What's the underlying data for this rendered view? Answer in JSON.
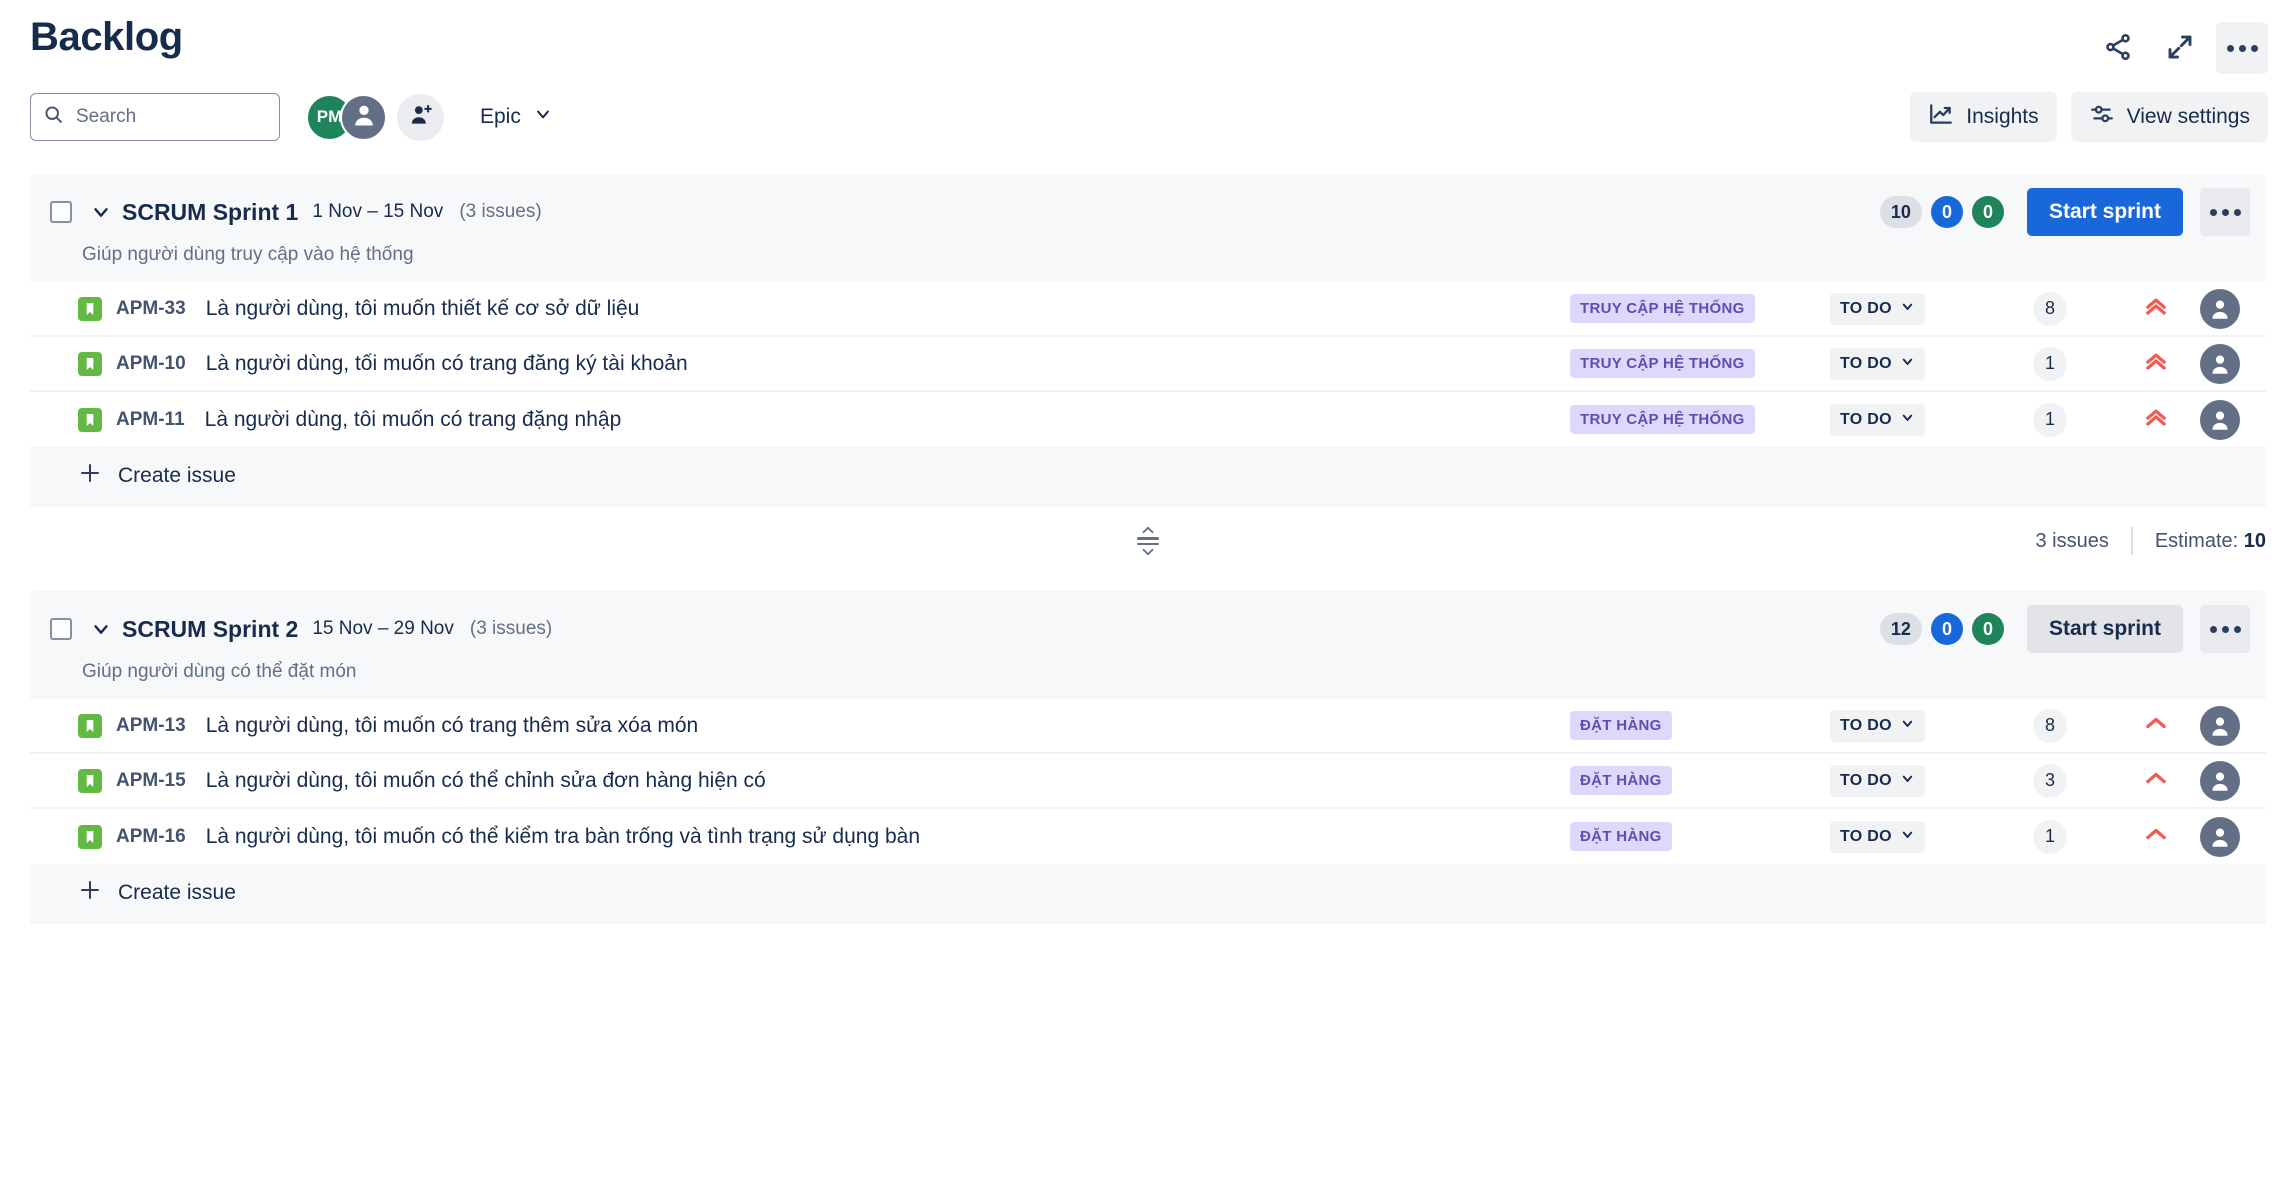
{
  "header": {
    "title": "Backlog",
    "actions": [
      {
        "name": "share-icon",
        "label": "Share"
      },
      {
        "name": "expand-icon",
        "label": "Expand"
      },
      {
        "name": "more-actions-icon",
        "label": "More actions"
      }
    ]
  },
  "toolbar": {
    "search": {
      "placeholder": "Search",
      "value": ""
    },
    "avatars": [
      {
        "initials": "PM",
        "color": "#1F845A"
      },
      {
        "initials": "",
        "color": "#626F86"
      }
    ],
    "add_people_label": "Add people",
    "epic_filter": {
      "label": "Epic"
    },
    "insights_label": "Insights",
    "view_settings_label": "View settings"
  },
  "sprints": [
    {
      "name": "SCRUM Sprint 1",
      "dates": "1 Nov – 15 Nov",
      "issue_count": "(3 issues)",
      "goal": "Giúp người dùng truy cập vào hệ thống",
      "badges": {
        "todo": "10",
        "inprogress": "0",
        "done": "0"
      },
      "start_button": "Start sprint",
      "start_button_style": "primary",
      "create_issue_label": "Create issue",
      "issues": [
        {
          "type": "story",
          "key": "APM-33",
          "summary": "Là người dùng, tôi muốn thiết kế cơ sở dữ liệu",
          "epic": "TRUY CẬP HỆ THỐNG",
          "status": "TO DO",
          "estimate": "8",
          "priority": "highest",
          "assignee": "unassigned"
        },
        {
          "type": "story",
          "key": "APM-10",
          "summary": "Là người dùng, tối muốn có trang đăng ký tài khoản",
          "epic": "TRUY CẬP HỆ THỐNG",
          "status": "TO DO",
          "estimate": "1",
          "priority": "highest",
          "assignee": "unassigned"
        },
        {
          "type": "story",
          "key": "APM-11",
          "summary": "Là người dùng, tôi muốn có trang đặng nhập",
          "epic": "TRUY CẬP HỆ THỐNG",
          "status": "TO DO",
          "estimate": "1",
          "priority": "highest",
          "assignee": "unassigned"
        }
      ],
      "footer": {
        "issues_text": "3 issues",
        "estimate_label": "Estimate:",
        "estimate_value": "10"
      }
    },
    {
      "name": "SCRUM Sprint 2",
      "dates": "15 Nov – 29 Nov",
      "issue_count": "(3 issues)",
      "goal": "Giúp người dùng có thể đặt món",
      "badges": {
        "todo": "12",
        "inprogress": "0",
        "done": "0"
      },
      "start_button": "Start sprint",
      "start_button_style": "secondary",
      "create_issue_label": "Create issue",
      "issues": [
        {
          "type": "story",
          "key": "APM-13",
          "summary": "Là người dùng, tôi muốn có trang thêm sửa xóa món",
          "epic": "ĐẶT HÀNG",
          "status": "TO DO",
          "estimate": "8",
          "priority": "high",
          "assignee": "unassigned"
        },
        {
          "type": "story",
          "key": "APM-15",
          "summary": "Là người dùng, tôi muốn có thể chỉnh sửa đơn hàng hiện có",
          "epic": "ĐẶT HÀNG",
          "status": "TO DO",
          "estimate": "3",
          "priority": "high",
          "assignee": "unassigned"
        },
        {
          "type": "story",
          "key": "APM-16",
          "summary": "Là người dùng, tôi muốn có thể kiểm tra bàn trống và tình trạng sử dụng bàn",
          "epic": "ĐẶT HÀNG",
          "status": "TO DO",
          "estimate": "1",
          "priority": "high",
          "assignee": "unassigned"
        }
      ]
    }
  ],
  "colors": {
    "primary_blue": "#1868DB",
    "green": "#1F845A",
    "epic_purple_bg": "#DFD8FD",
    "epic_purple_text": "#5E4DB2",
    "priority_orange": "#F15B50",
    "story_green": "#62BA45",
    "text_dark": "#172B4D",
    "text_subtle": "#626F86",
    "card_bg": "#F7F8F9"
  }
}
